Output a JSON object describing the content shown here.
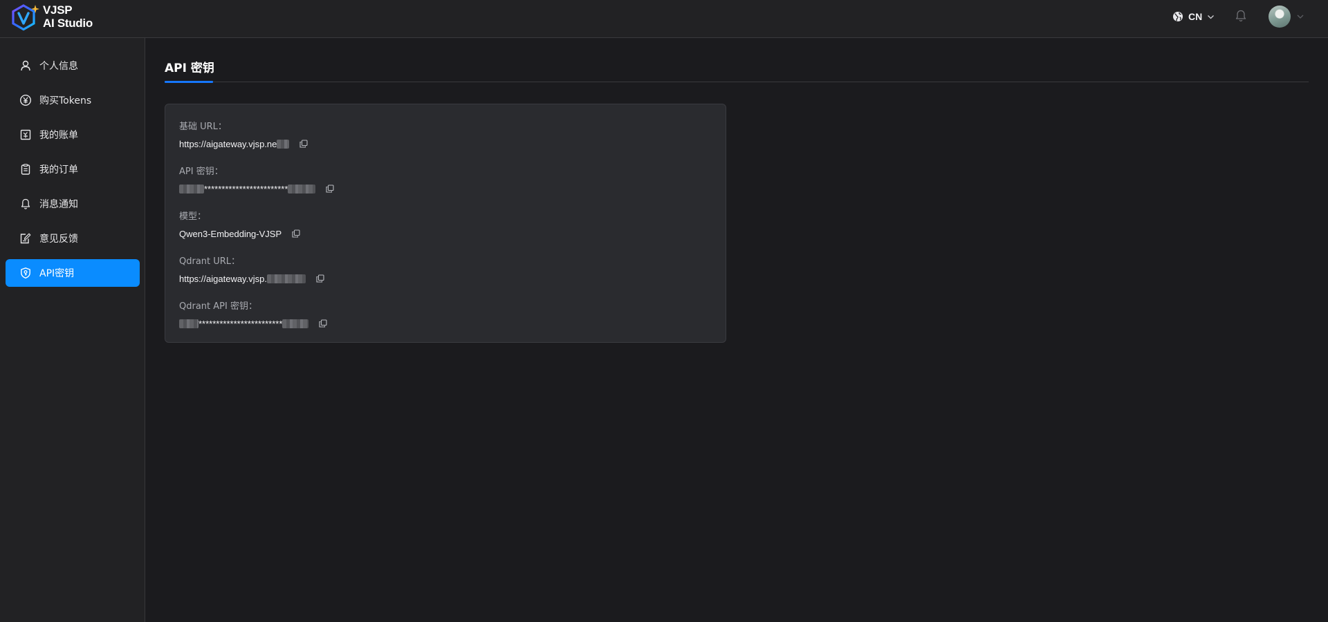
{
  "header": {
    "brand_line1": "VJSP",
    "brand_line2": "AI Studio",
    "language": "CN",
    "icons": [
      "logo-icon",
      "globe-icon",
      "chevron-down-icon",
      "bell-icon",
      "avatar"
    ]
  },
  "sidebar": {
    "items": [
      {
        "label": "个人信息",
        "icon": "user-icon",
        "active": false
      },
      {
        "label": "购买Tokens",
        "icon": "yen-icon",
        "active": false
      },
      {
        "label": "我的账单",
        "icon": "bill-icon",
        "active": false
      },
      {
        "label": "我的订单",
        "icon": "clipboard-icon",
        "active": false
      },
      {
        "label": "消息通知",
        "icon": "bell-icon",
        "active": false
      },
      {
        "label": "意见反馈",
        "icon": "edit-icon",
        "active": false
      },
      {
        "label": "API密钥",
        "icon": "shield-key-icon",
        "active": true
      }
    ]
  },
  "main": {
    "title": "API 密钥",
    "fields": [
      {
        "label": "基础 URL：",
        "value": "https://aigateway.vjsp.ne",
        "masked_suffix": true
      },
      {
        "label": "API 密钥：",
        "value": "************************",
        "masked_prefix": true,
        "masked_suffix": true
      },
      {
        "label": "模型：",
        "value": "Qwen3-Embedding-VJSP"
      },
      {
        "label": "Qdrant URL：",
        "value": "https://aigateway.vjsp.",
        "masked_suffix": true
      },
      {
        "label": "Qdrant API 密钥：",
        "value": "************************",
        "masked_prefix": true,
        "masked_suffix": true
      }
    ]
  },
  "colors": {
    "accent": "#0a8cff",
    "underline": "#1677ff",
    "background": "#1b1b1e",
    "panel": "#222224",
    "card": "#2a2b2f"
  }
}
